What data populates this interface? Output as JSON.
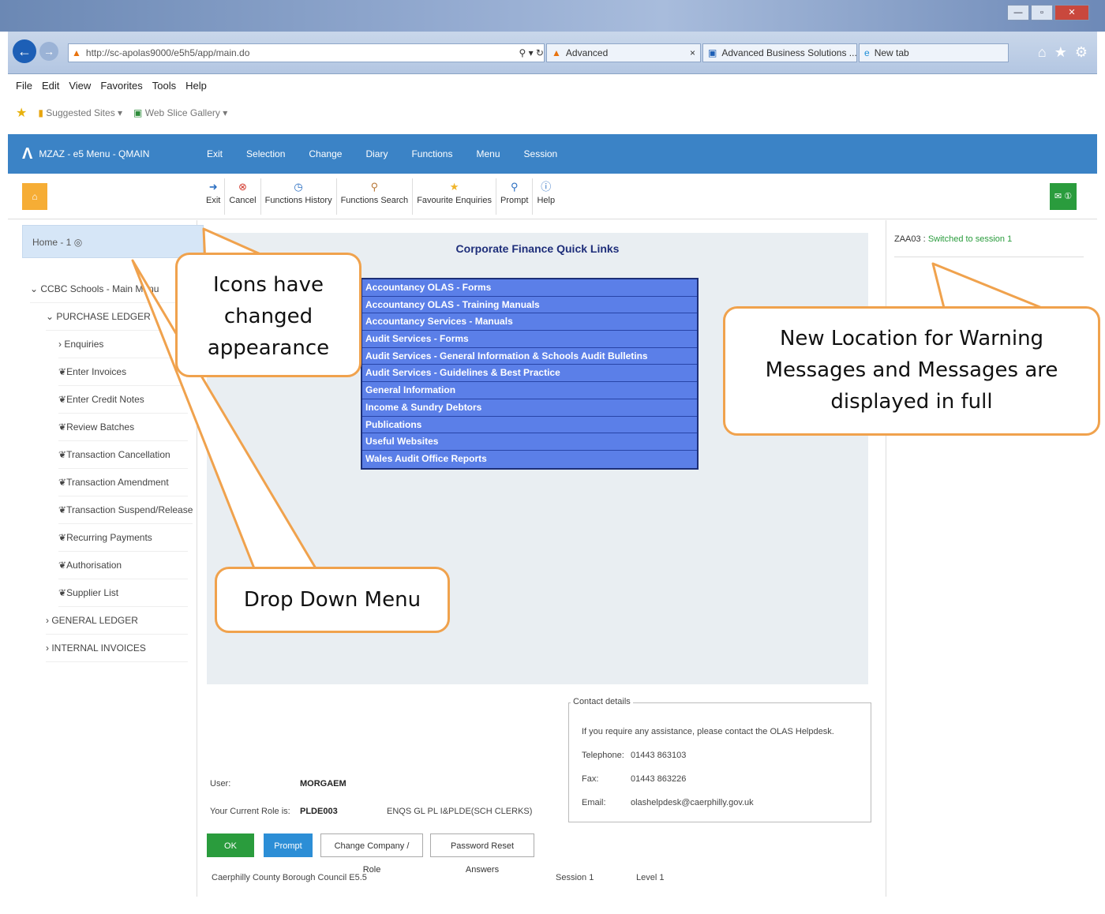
{
  "browser": {
    "address": "http://sc-apolas9000/e5h5/app/main.do",
    "tabs": [
      "Advanced",
      "Advanced Business Solutions ...",
      "New tab"
    ],
    "menu": [
      "File",
      "Edit",
      "View",
      "Favorites",
      "Tools",
      "Help"
    ],
    "favorites": [
      "Suggested Sites ▾",
      "Web Slice Gallery ▾"
    ]
  },
  "app": {
    "title": "MZAZ - e5 Menu - QMAIN",
    "nav": [
      "Exit",
      "Selection",
      "Change",
      "Diary",
      "Functions",
      "Menu",
      "Session"
    ],
    "tools": [
      "Exit",
      "Cancel",
      "Functions History",
      "Functions Search",
      "Favourite Enquiries",
      "Prompt",
      "Help"
    ]
  },
  "left": {
    "crumb": "Home - 1",
    "root": "CCBC Schools - Main Menu",
    "purchase": "PURCHASE LEDGER",
    "items": [
      "Enquiries",
      "Enter Invoices",
      "Enter Credit Notes",
      "Review Batches",
      "Transaction Cancellation",
      "Transaction Amendment",
      "Transaction Suspend/Release",
      "Recurring Payments",
      "Authorisation",
      "Supplier List"
    ],
    "general": "GENERAL LEDGER",
    "internal": "INTERNAL INVOICES"
  },
  "main": {
    "title": "Corporate Finance Quick Links",
    "links": [
      "Accountancy OLAS - Forms",
      "Accountancy OLAS - Training Manuals",
      "Accountancy Services - Manuals",
      "Audit Services - Forms",
      "Audit Services - General Information & Schools Audit Bulletins",
      "Audit Services - Guidelines & Best Practice",
      "General Information",
      "Income & Sundry Debtors",
      "Publications",
      "Useful Websites",
      "Wales Audit Office Reports"
    ]
  },
  "contact": {
    "legend": "Contact details",
    "intro": "If you require any assistance, please contact the OLAS Helpdesk.",
    "tel_label": "Telephone:",
    "tel": "01443 863103",
    "fax_label": "Fax:",
    "fax": "01443 863226",
    "email_label": "Email:",
    "email": "olashelpdesk@caerphilly.gov.uk"
  },
  "user": {
    "user_label": "User:",
    "user": "MORGAEM",
    "role_label": "Your Current Role is:",
    "role": "PLDE003",
    "role_desc": "ENQS GL PL I&PLDE(SCH CLERKS)"
  },
  "buttons": {
    "ok": "OK",
    "prompt": "Prompt",
    "change": "Change Company / Role",
    "reset": "Password Reset Answers"
  },
  "footer": {
    "council": "Caerphilly County Borough Council E5.5",
    "session": "Session   1",
    "level": "Level   1"
  },
  "right": {
    "code": "ZAA03 :",
    "message": "Switched to session 1"
  },
  "callouts": {
    "icons": "Icons have changed appearance",
    "dropdown": "Drop Down Menu",
    "warning": "New Location for Warning Messages and Messages are displayed in full"
  },
  "colors": {
    "appbar": "#3b83c6",
    "callout_border": "#f0a24d",
    "quicklink": "#5b7fe8",
    "ok": "#2a9c3d",
    "prompt": "#2c8ed6"
  }
}
